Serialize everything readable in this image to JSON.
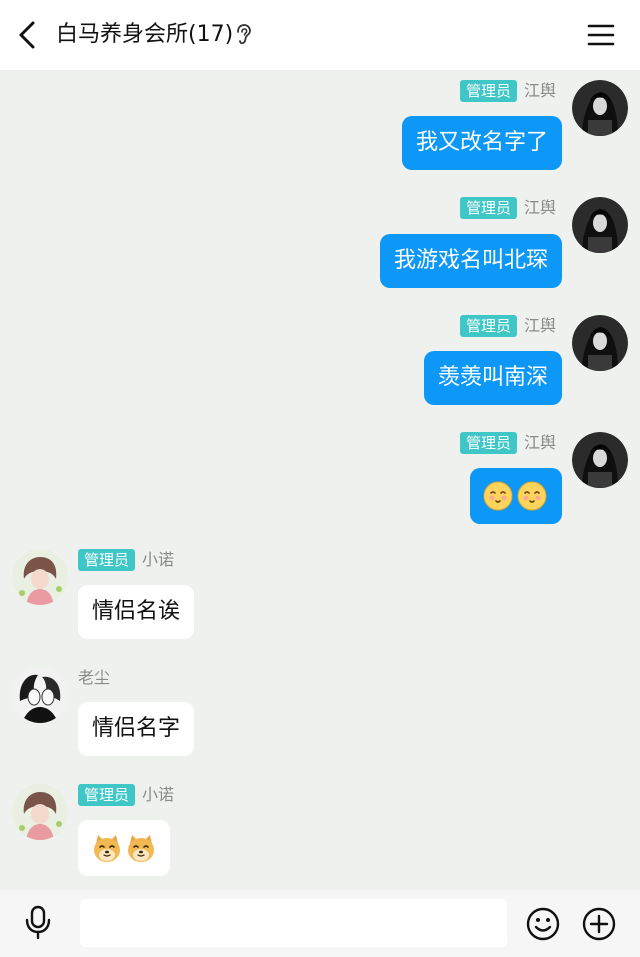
{
  "header": {
    "title": "白马养身会所(17)"
  },
  "messages": [
    {
      "direction": "out",
      "badge": "管理员",
      "nickname": "江舆",
      "text": "我又改名字了"
    },
    {
      "direction": "out",
      "badge": "管理员",
      "nickname": "江舆",
      "text": "我游戏名叫北琛"
    },
    {
      "direction": "out",
      "badge": "管理员",
      "nickname": "江舆",
      "text": "羡羡叫南深"
    },
    {
      "direction": "out",
      "badge": "管理员",
      "nickname": "江舆",
      "text": "",
      "stickers": [
        "smirk-emoji",
        "smirk-emoji"
      ]
    },
    {
      "direction": "in",
      "badge": "管理员",
      "nickname": "小诺",
      "text": "情侣名诶"
    },
    {
      "direction": "in",
      "badge": "",
      "nickname": "老尘",
      "text": "情侣名字"
    },
    {
      "direction": "in",
      "badge": "管理员",
      "nickname": "小诺",
      "text": "",
      "stickers": [
        "doge-emoji",
        "doge-emoji"
      ]
    }
  ],
  "composer": {
    "placeholder": ""
  },
  "colors": {
    "chat_background": "#eef1ed",
    "outgoing_bubble": "#0d97f7",
    "incoming_bubble": "#ffffff",
    "admin_badge": "#3ec7c6"
  },
  "icons": {
    "back": "chevron-left-icon",
    "ear": "ear-icon",
    "menu": "hamburger-menu-icon",
    "voice": "microphone-icon",
    "emoji": "smiley-icon",
    "more": "plus-circle-icon"
  }
}
